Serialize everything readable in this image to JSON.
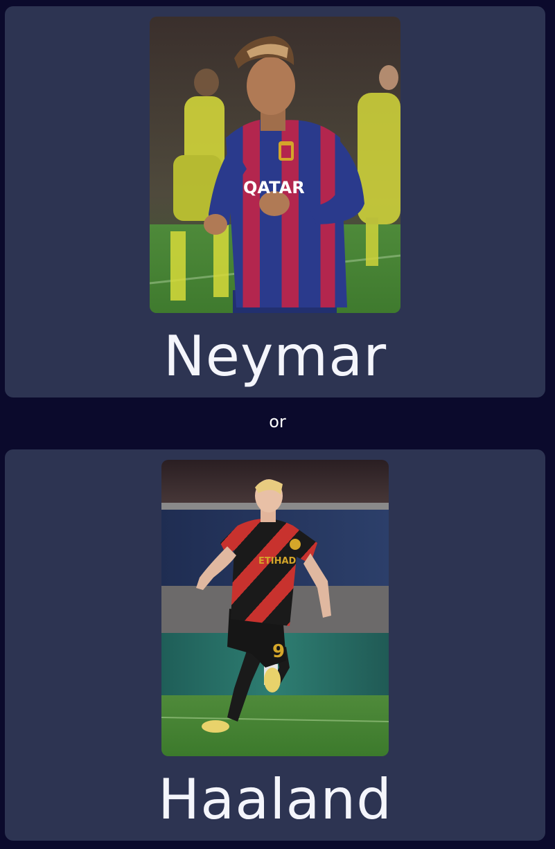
{
  "option_a": {
    "name": "Neymar",
    "photo": "neymar-photo"
  },
  "separator": "or",
  "option_b": {
    "name": "Haaland",
    "photo": "haaland-photo"
  },
  "colors": {
    "background": "#0b0a2c",
    "card": "#2d3452",
    "text": "#f4f5fb"
  }
}
